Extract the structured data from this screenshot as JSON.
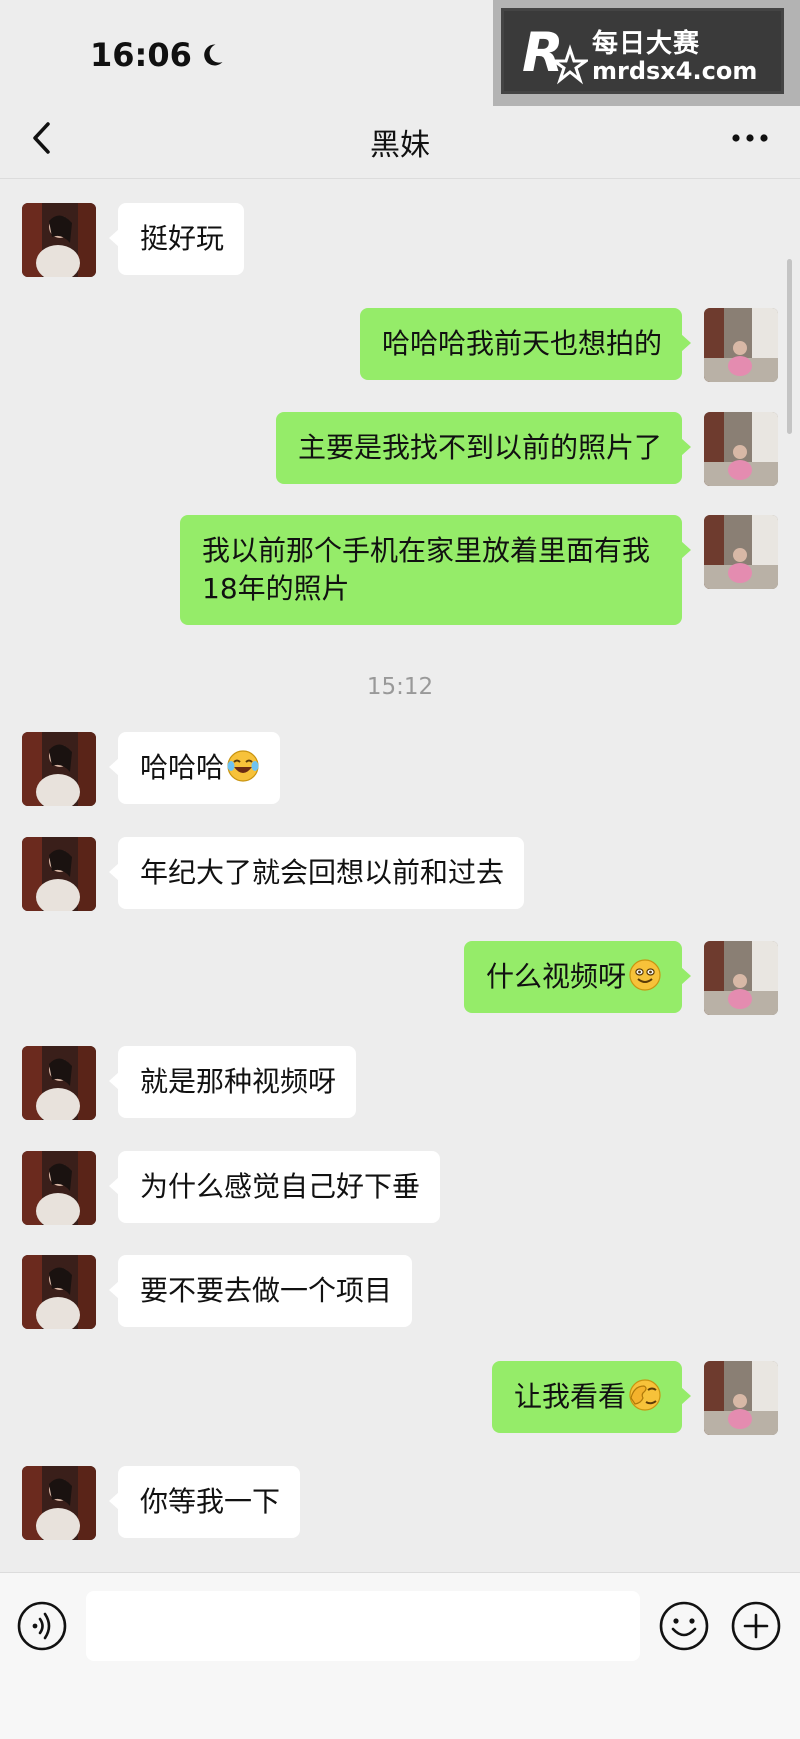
{
  "status_bar": {
    "time": "16:06"
  },
  "nav": {
    "title": "黑妹"
  },
  "watermark": {
    "line1": "每日大赛",
    "line2": "mrdsx4.com"
  },
  "messages": [
    {
      "side": "left",
      "text": "挺好玩"
    },
    {
      "side": "right",
      "text": "哈哈哈我前天也想拍的"
    },
    {
      "side": "right",
      "text": "主要是我找不到以前的照片了"
    },
    {
      "side": "right",
      "text": "我以前那个手机在家里放着里面有我18年的照片"
    },
    {
      "divider": "15:12"
    },
    {
      "side": "left",
      "text": "哈哈哈",
      "emoji": "tears-of-joy-emoji"
    },
    {
      "side": "left",
      "text": "年纪大了就会回想以前和过去"
    },
    {
      "side": "right",
      "text": "什么视频呀",
      "emoji": "smile-emoji"
    },
    {
      "side": "left",
      "text": "就是那种视频呀"
    },
    {
      "side": "left",
      "text": "为什么感觉自己好下垂"
    },
    {
      "side": "left",
      "text": "要不要去做一个项目"
    },
    {
      "side": "right",
      "text": "让我看看",
      "emoji": "facepalm-emoji"
    },
    {
      "side": "left",
      "text": "你等我一下"
    }
  ],
  "input": {
    "value": "",
    "placeholder": ""
  },
  "colors": {
    "background": "#ededed",
    "sent_bubble": "#95ec69",
    "received_bubble": "#ffffff"
  }
}
